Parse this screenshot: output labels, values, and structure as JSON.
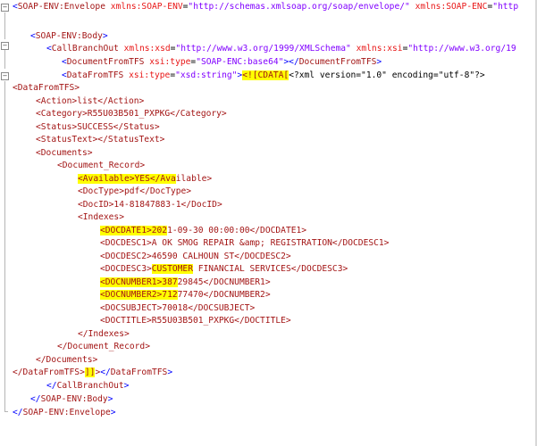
{
  "colors": {
    "tag": "#a31515",
    "bracket": "#0000ff",
    "attribute": "#e81616",
    "attribute_value": "#8000ff",
    "highlight": "#ffff00"
  },
  "lines": [
    {
      "text": "<SOAP-ENV:Envelope xmlns:SOAP-ENV=\"http://schemas.xmlsoap.org/soap/envelope/\" xmlns:SOAP-ENC=\"http"
    },
    {
      "text": "<SOAP-ENV:Body>"
    },
    {
      "text": "<CallBranchOut xmlns:xsd=\"http://www.w3.org/1999/XMLSchema\" xmlns:xsi=\"http://www.w3.org/19"
    },
    {
      "text": "<DocumentFromTFS xsi:type=\"SOAP-ENC:base64\"></DocumentFromTFS>"
    },
    {
      "text": "<DataFromTFS xsi:type=\"xsd:string\"><![CDATA[<?xml version=\"1.0\" encoding=\"utf-8\"?>"
    },
    {
      "text": "<DataFromTFS>"
    },
    {
      "text": "<Action>list</Action>"
    },
    {
      "text": "<Category>R55U03B501_PXPKG</Category>"
    },
    {
      "text": "<Status>SUCCESS</Status>"
    },
    {
      "text": "<StatusText></StatusText>"
    },
    {
      "text": "<Documents>"
    },
    {
      "text": "<Document_Record>"
    },
    {
      "text": "<Available>YES</Available>"
    },
    {
      "text": "<DocType>pdf</DocType>"
    },
    {
      "text": "<DocID>14-81847883-1</DocID>"
    },
    {
      "text": "<Indexes>"
    },
    {
      "text": "<DOCDATE1>2021-09-30 00:00:00</DOCDATE1>"
    },
    {
      "text": "<DOCDESC1>A OK SMOG REPAIR &amp; REGISTRATION</DOCDESC1>"
    },
    {
      "text": "<DOCDESC2>46590 CALHOUN ST</DOCDESC2>"
    },
    {
      "text": "<DOCDESC3>CUSTOMER FINANCIAL SERVICES</DOCDESC3>"
    },
    {
      "text": "<DOCNUMBER1>38729845</DOCNUMBER1>"
    },
    {
      "text": "<DOCNUMBER2>71277470</DOCNUMBER2>"
    },
    {
      "text": "<DOCSUBJECT>70018</DOCSUBJECT>"
    },
    {
      "text": "<DOCTITLE>R55U03B501_PXPKG</DOCTITLE>"
    },
    {
      "text": "</Indexes>"
    },
    {
      "text": "</Document_Record>"
    },
    {
      "text": "</Documents>"
    },
    {
      "text": "</DataFromTFS>]]></DataFromTFS>"
    },
    {
      "text": "</CallBranchOut>"
    },
    {
      "text": "</SOAP-ENV:Body>"
    },
    {
      "text": "</SOAP-ENV:Envelope>"
    }
  ]
}
